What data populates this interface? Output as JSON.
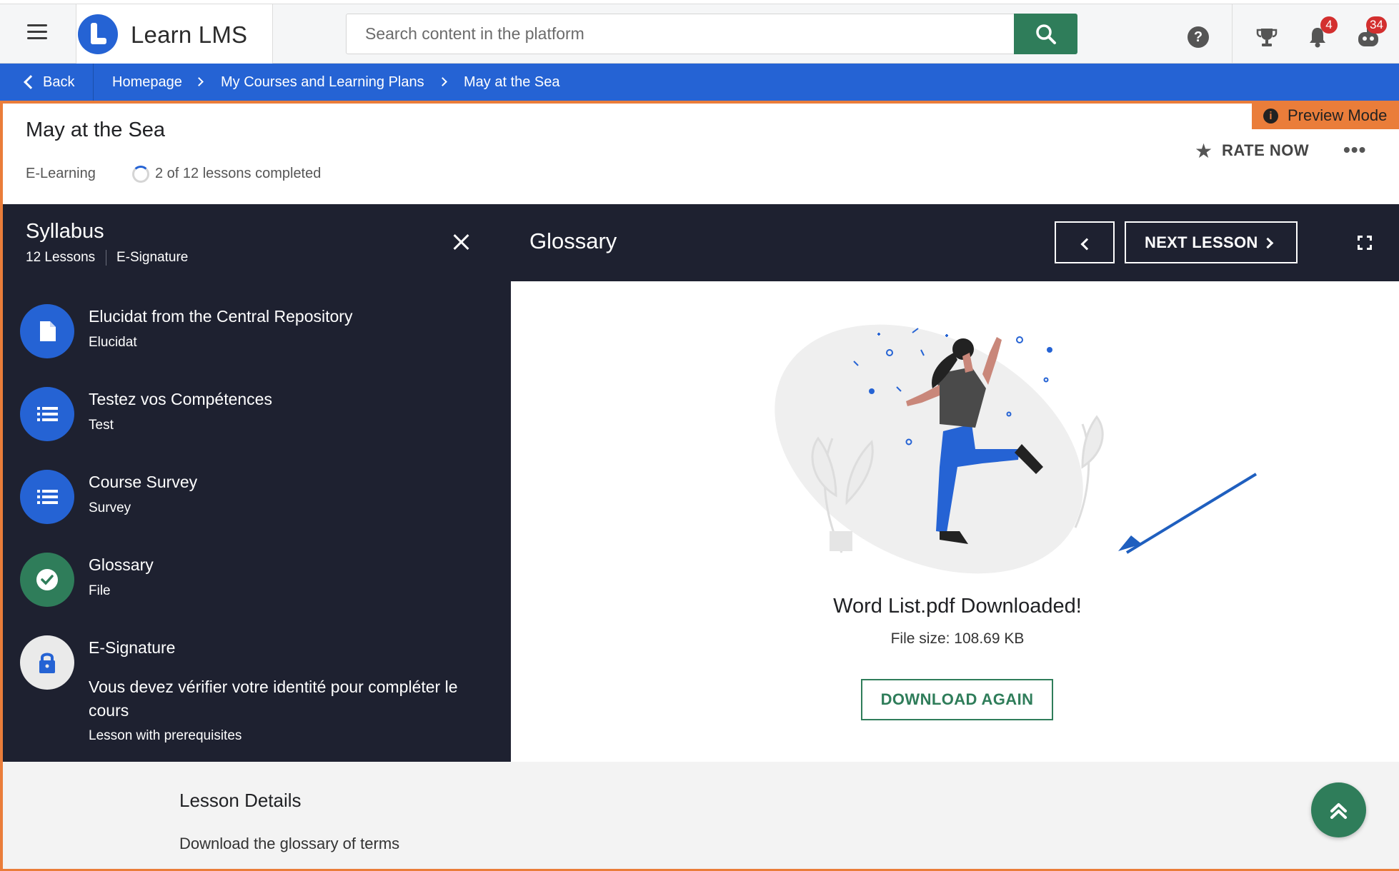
{
  "app": {
    "name": "Learn LMS"
  },
  "search": {
    "placeholder": "Search content in the platform"
  },
  "header": {
    "notifications_count": "4",
    "messages_count": "34"
  },
  "breadcrumb": {
    "back": "Back",
    "items": [
      "Homepage",
      "My Courses and Learning Plans",
      "May at the Sea"
    ]
  },
  "preview_mode": "Preview Mode",
  "course": {
    "title": "May at the Sea",
    "type": "E-Learning",
    "progress_text": "2 of 12 lessons completed",
    "progress_fraction": 0.1667,
    "rate_label": "RATE NOW"
  },
  "syllabus": {
    "title": "Syllabus",
    "count": "12 Lessons",
    "tag": "E-Signature",
    "lessons": [
      {
        "name": "Elucidat from the Central Repository",
        "type": "Elucidat",
        "icon": "file-icon",
        "status": "default"
      },
      {
        "name": "Testez vos Compétences",
        "type": "Test",
        "icon": "list-icon",
        "status": "default"
      },
      {
        "name": "Course Survey",
        "type": "Survey",
        "icon": "list-icon",
        "status": "default"
      },
      {
        "name": "Glossary",
        "type": "File",
        "icon": "check-icon",
        "status": "completed"
      },
      {
        "name": "E-Signature",
        "type": "Lesson with prerequisites",
        "icon": "lock-icon",
        "status": "locked",
        "note": "Vous devez vérifier votre identité pour compléter le cours"
      }
    ]
  },
  "lesson_view": {
    "title": "Glossary",
    "next_label": "NEXT LESSON",
    "download_title": "Word List.pdf Downloaded!",
    "file_size": "File size: 108.69 KB",
    "download_again": "DOWNLOAD AGAIN"
  },
  "lesson_details": {
    "title": "Lesson Details",
    "description": "Download the glossary of terms"
  },
  "colors": {
    "brand_blue": "#2563d4",
    "accent_green": "#2f7d5a",
    "preview_orange": "#ea7d3a",
    "dark_panel": "#1e2130",
    "badge_red": "#d32f2f"
  }
}
